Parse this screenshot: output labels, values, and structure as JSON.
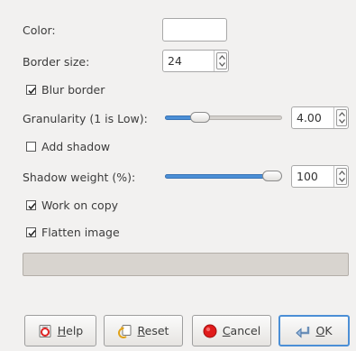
{
  "form": {
    "color_label": "Color:",
    "border_size_label": "Border size:",
    "border_size_value": "24",
    "blur_border_label": "Blur border",
    "blur_border_checked": true,
    "granularity_label": "Granularity (1 is Low):",
    "granularity_value": "4.00",
    "granularity_fraction": 0.26,
    "add_shadow_label": "Add shadow",
    "add_shadow_checked": false,
    "shadow_weight_label": "Shadow weight (%):",
    "shadow_weight_value": "100",
    "shadow_weight_fraction": 1.0,
    "work_on_copy_label": "Work on copy",
    "work_on_copy_checked": true,
    "flatten_image_label": "Flatten image",
    "flatten_image_checked": true,
    "color_value": "#ffffff"
  },
  "buttons": {
    "help_mnemonic": "H",
    "help_rest": "elp",
    "reset_mnemonic": "R",
    "reset_rest": "eset",
    "cancel_mnemonic": "C",
    "cancel_rest": "ancel",
    "ok_mnemonic": "O",
    "ok_rest": "K"
  },
  "icons": {
    "help": "help-icon",
    "reset": "reset-icon",
    "cancel": "cancel-icon",
    "ok": "ok-icon"
  },
  "colors": {
    "accent": "#4b8fd6",
    "background": "#f2f1f0"
  }
}
